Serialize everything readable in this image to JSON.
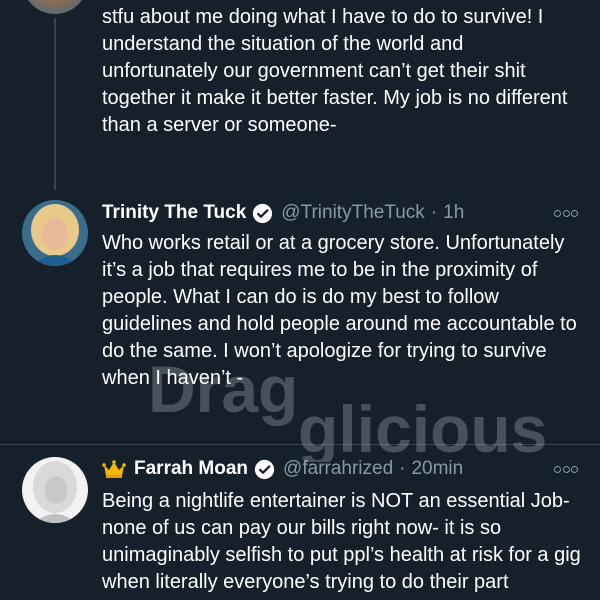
{
  "tweets": [
    {
      "text": "stfu about me doing what I have to do to survive! I understand the situation of the world and unfortunately our government can’t get their shit together it make it better faster. My job is no different than a server or someone-"
    },
    {
      "name": "Trinity The Tuck",
      "handle": "@TrinityTheTuck",
      "separator": "·",
      "time": "1h",
      "text": "Who works retail or at a grocery store. Unfortunately it’s a job that requires me to be in the proximity of people. What I can do is do my best to follow guidelines and hold people around me accountable to do the same. I won’t apologize for trying to survive when I haven’t -"
    },
    {
      "name": "Farrah Moan",
      "handle": "@farrahrized",
      "separator": "·",
      "time": "20min",
      "text": "Being a nightlife entertainer is NOT an essential Job- none of us can pay our bills right now- it is so unimaginably selfish to put ppl’s health at risk for a gig when literally everyone’s trying to do their part"
    }
  ],
  "watermark": {
    "line1": "Drag",
    "line2": "glicious"
  },
  "colors": {
    "background": "#15202b",
    "secondary_text": "#8899a6",
    "verified": "#ffffff",
    "divider": "#38444d"
  }
}
